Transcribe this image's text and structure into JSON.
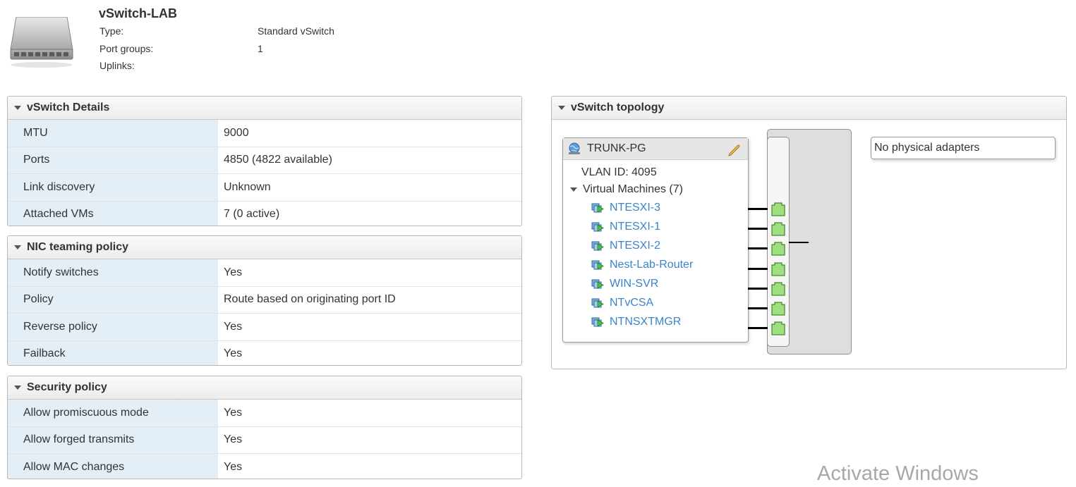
{
  "header": {
    "title": "vSwitch-LAB",
    "icon": "vswitch-icon",
    "props": [
      {
        "key": "Type:",
        "value": "Standard vSwitch"
      },
      {
        "key": "Port groups:",
        "value": "1"
      },
      {
        "key": "Uplinks:",
        "value": ""
      }
    ]
  },
  "details": {
    "title": "vSwitch Details",
    "rows": [
      {
        "key": "MTU",
        "value": "9000"
      },
      {
        "key": "Ports",
        "value": "4850 (4822 available)"
      },
      {
        "key": "Link discovery",
        "value": "Unknown"
      },
      {
        "key": "Attached VMs",
        "value": "7 (0 active)"
      }
    ]
  },
  "nic_teaming": {
    "title": "NIC teaming policy",
    "rows": [
      {
        "key": "Notify switches",
        "value": "Yes"
      },
      {
        "key": "Policy",
        "value": "Route based on originating port ID"
      },
      {
        "key": "Reverse policy",
        "value": "Yes"
      },
      {
        "key": "Failback",
        "value": "Yes"
      }
    ]
  },
  "security": {
    "title": "Security policy",
    "rows": [
      {
        "key": "Allow promiscuous mode",
        "value": "Yes"
      },
      {
        "key": "Allow forged transmits",
        "value": "Yes"
      },
      {
        "key": "Allow MAC changes",
        "value": "Yes"
      }
    ]
  },
  "topology": {
    "title": "vSwitch topology",
    "port_group": {
      "name": "TRUNK-PG",
      "vlan": "VLAN ID: 4095",
      "vms_label": "Virtual Machines (7)",
      "vms": [
        "NTESXI-3",
        "NTESXI-1",
        "NTESXI-2",
        "Nest-Lab-Router",
        "WIN-SVR",
        "NTvCSA",
        "NTNSXTMGR"
      ]
    },
    "adapters_text": "No physical adapters"
  },
  "watermark": "Activate Windows",
  "colors": {
    "link": "#3b84c7",
    "key_bg": "#e4eef6",
    "port_green": "#9ee07e"
  }
}
